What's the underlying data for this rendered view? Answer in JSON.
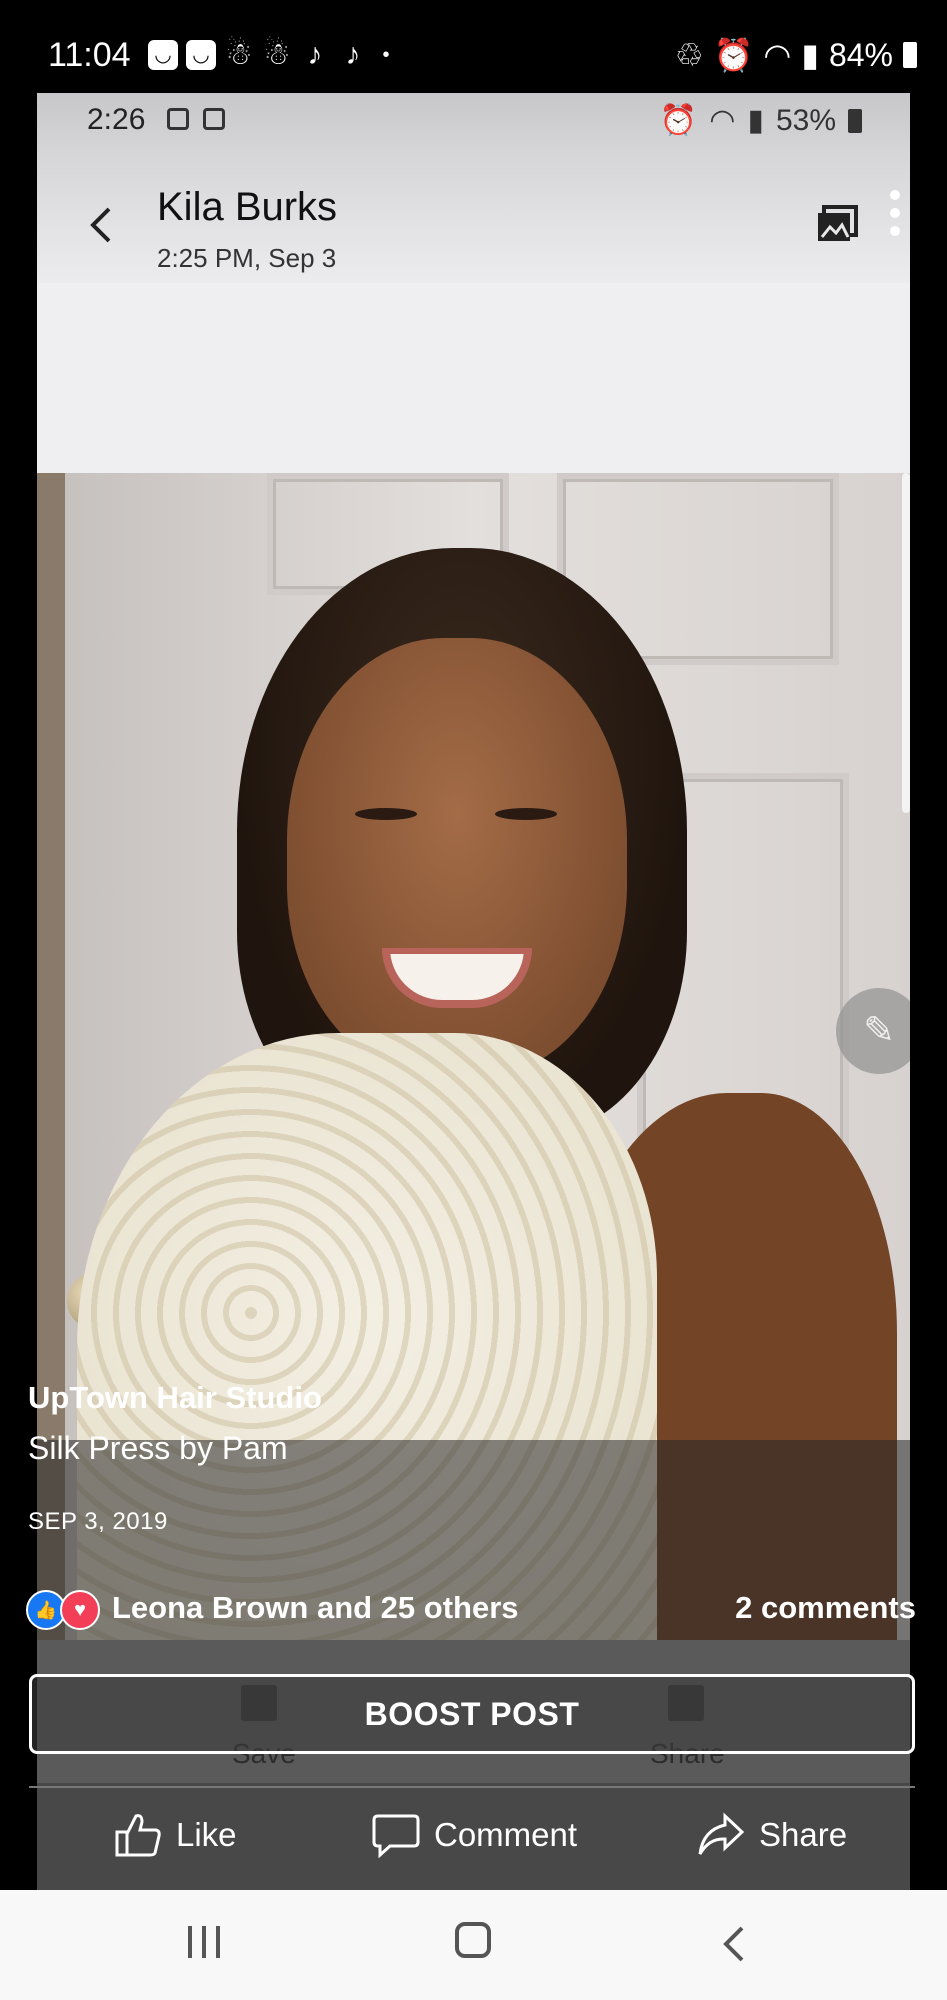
{
  "outer_status": {
    "time": "11:04",
    "battery": "84%"
  },
  "inner_status": {
    "time": "2:26",
    "battery": "53%"
  },
  "header": {
    "name": "Kila Burks",
    "date": "2:25 PM, Sep 3"
  },
  "post": {
    "page_name": "UpTown Hair Studio",
    "description": "Silk Press  by Pam",
    "date": "SEP 3, 2019",
    "reactors": "Leona Brown and 25 others",
    "comments": "2 comments",
    "boost_label": "BOOST POST",
    "ghost_save": "Save",
    "ghost_share": "Share"
  },
  "actions": {
    "like": "Like",
    "comment": "Comment",
    "share": "Share"
  },
  "colors": {
    "like_reaction": "#1877f2",
    "love_reaction": "#f33e58"
  }
}
